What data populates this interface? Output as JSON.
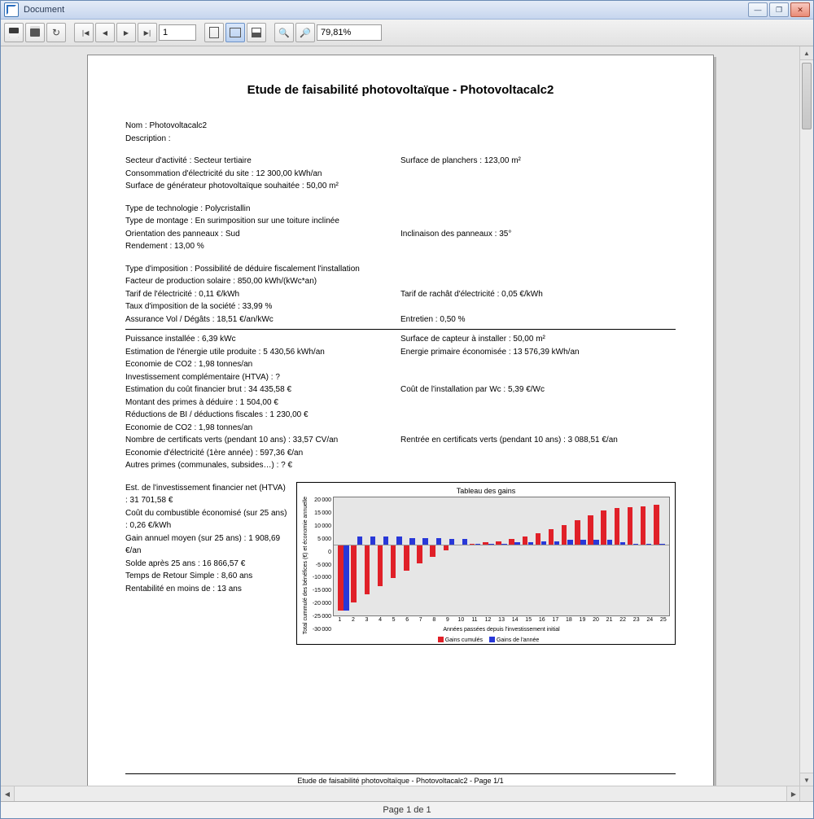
{
  "window": {
    "title": "Document"
  },
  "toolbar": {
    "page_field": "1",
    "zoom_field": "79,81%"
  },
  "status": {
    "text": "Page 1 de 1"
  },
  "doc": {
    "title": "Etude de faisabilité photovoltaïque - Photovoltacalc2",
    "nom": "Nom : Photovoltacalc2",
    "description": "Description :",
    "secteur": "Secteur d'activité : Secteur tertiaire",
    "surface_planchers": "Surface de planchers : 123,00 m²",
    "consommation": "Consommation d'électricité du site : 12 300,00 kWh/an",
    "surface_gen": "Surface de générateur photovoltaïque souhaitée : 50,00 m²",
    "type_tech": "Type de technologie : Polycristallin",
    "type_montage": "Type de montage : En surimposition sur une toiture inclinée",
    "orientation": "Orientation des panneaux : Sud",
    "inclinaison": "Inclinaison des panneaux : 35°",
    "rendement": "Rendement : 13,00 %",
    "type_imposition": "Type d'imposition : Possibilité de déduire fiscalement l'installation",
    "facteur_prod": "Facteur de production solaire : 850,00 kWh/(kWc*an)",
    "tarif_elec": "Tarif de l'électricité : 0,11 €/kWh",
    "tarif_rachat": "Tarif de rachât d'électricité : 0,05 €/kWh",
    "taux_imposition": "Taux d'imposition de la société : 33,99 %",
    "assurance": "Assurance Vol / Dégâts : 18,51 €/an/kWc",
    "entretien": "Entretien : 0,50 %",
    "puissance": "Puissance installée : 6,39 kWc",
    "surface_capteur": "Surface de capteur à installer : 50,00 m²",
    "energie_utile": "Estimation de l'énergie utile produite : 5 430,56 kWh/an",
    "energie_primaire": "Energie primaire économisée : 13 576,39 kWh/an",
    "eco_co2_a": "Economie de CO2 : 1,98 tonnes/an",
    "invest_comp": "Investissement complémentaire (HTVA) : ?",
    "cout_brut": "Estimation du coût financier brut : 34 435,58 €",
    "cout_wc": "Coût de l'installation par Wc : 5,39 €/Wc",
    "primes": "Montant des primes à déduire : 1 504,00 €",
    "reductions": "Réductions de BI / déductions fiscales : 1 230,00 €",
    "eco_co2_b": "Economie de CO2 : 1,98 tonnes/an",
    "cert_verts": "Nombre de certificats verts (pendant 10 ans) : 33,57 CV/an",
    "rentree_cert": "Rentrée en certificats verts (pendant 10 ans) : 3 088,51 €/an",
    "eco_elec": "Economie d'électricité (1ère année) : 597,36 €/an",
    "autres_primes": "Autres primes (communales, subsides…) : ? €",
    "invest_net": "Est. de l'investissement financier net (HTVA) : 31 701,58 €",
    "cout_combustible": "Coût du combustible économisé (sur 25 ans) : 0,26 €/kWh",
    "gain_annuel": "Gain annuel moyen (sur 25 ans) : 1 908,69 €/an",
    "solde": "Solde après 25 ans : 16 866,57 €",
    "temps_retour": "Temps de Retour Simple : 8,60 ans",
    "rentabilite": "Rentabilité en moins de : 13 ans",
    "footer": "Etude de faisabilité photovoltaïque - Photovoltacalc2 - Page 1/1"
  },
  "chart_data": {
    "type": "bar",
    "title": "Tableau des gains",
    "xlabel": "Années passées depuis l'investissement initial",
    "ylabel": "Total cummulé des bénéfices (€) et économie annuelle",
    "categories": [
      1,
      2,
      3,
      4,
      5,
      6,
      7,
      8,
      9,
      10,
      11,
      12,
      13,
      14,
      15,
      16,
      17,
      18,
      19,
      20,
      21,
      22,
      23,
      24,
      25
    ],
    "ylim": [
      -30000,
      20000
    ],
    "yticks": [
      -30000,
      -25000,
      -20000,
      -15000,
      -10000,
      -5000,
      0,
      5000,
      10000,
      15000,
      20000
    ],
    "series": [
      {
        "name": "Gains cumulés",
        "color": "#e02028",
        "values": [
          -28000,
          -24500,
          -21000,
          -17500,
          -14000,
          -11000,
          -8000,
          -5000,
          -2500,
          0,
          500,
          1000,
          1500,
          2500,
          3500,
          5000,
          6500,
          8500,
          10500,
          12500,
          14500,
          15500,
          16000,
          16500,
          17000
        ]
      },
      {
        "name": "Gains de l'année",
        "color": "#2838d8",
        "values": [
          -28000,
          3500,
          3500,
          3500,
          3500,
          3000,
          3000,
          3000,
          2500,
          2500,
          500,
          500,
          500,
          1000,
          1000,
          1500,
          1500,
          2000,
          2000,
          2000,
          2000,
          1000,
          500,
          500,
          500
        ]
      }
    ],
    "legend": [
      "Gains cumulés",
      "Gains de l'année"
    ]
  }
}
